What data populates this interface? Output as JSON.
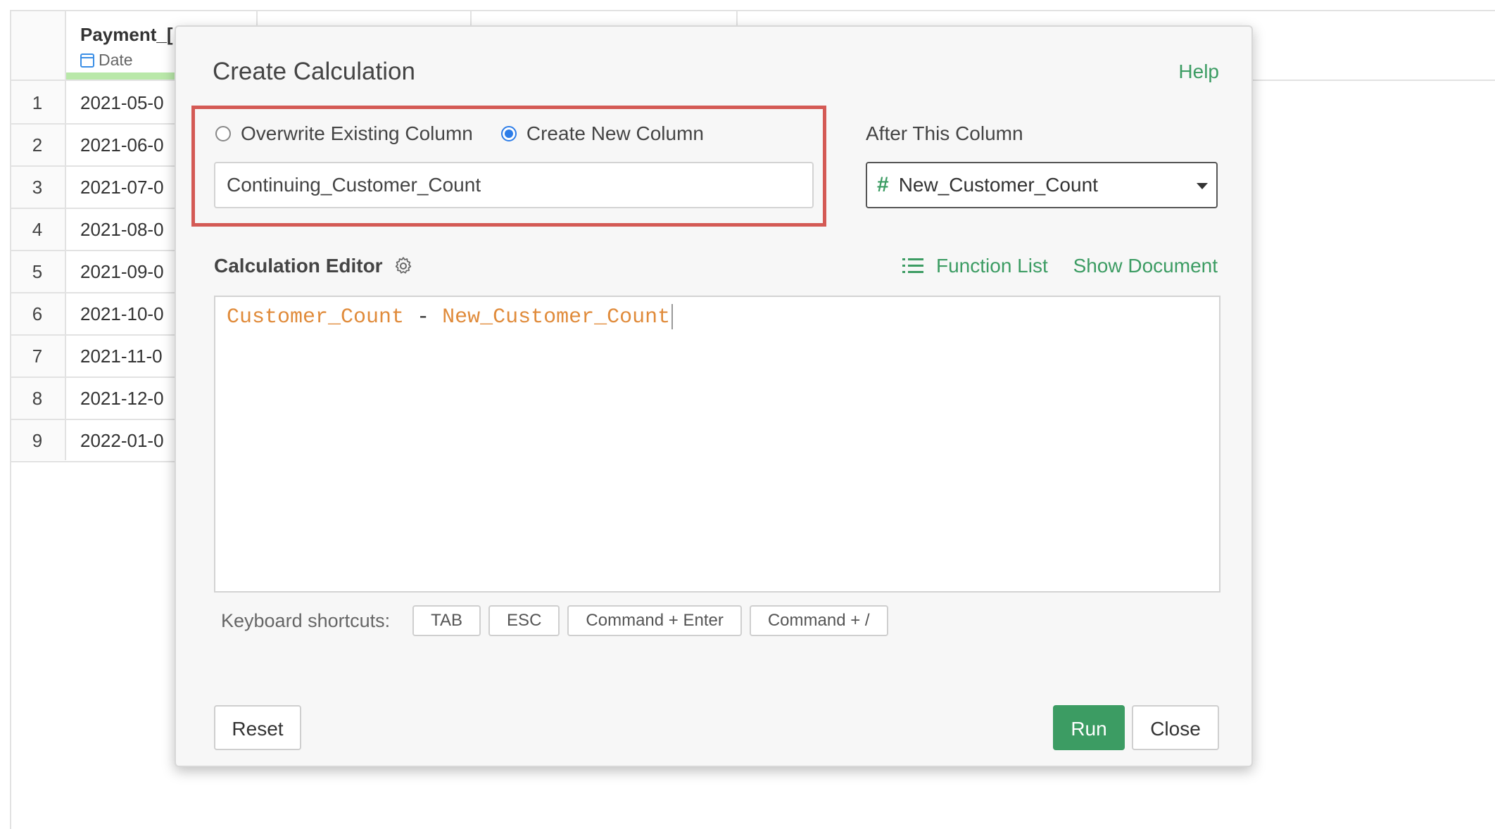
{
  "grid": {
    "column": {
      "name": "Payment_[",
      "type_label": "Date",
      "type_icon": "calendar-icon"
    },
    "rows": [
      {
        "num": "1",
        "value": "2021-05-0"
      },
      {
        "num": "2",
        "value": "2021-06-0"
      },
      {
        "num": "3",
        "value": "2021-07-0"
      },
      {
        "num": "4",
        "value": "2021-08-0"
      },
      {
        "num": "5",
        "value": "2021-09-0"
      },
      {
        "num": "6",
        "value": "2021-10-0"
      },
      {
        "num": "7",
        "value": "2021-11-0"
      },
      {
        "num": "8",
        "value": "2021-12-0"
      },
      {
        "num": "9",
        "value": "2022-01-0"
      }
    ]
  },
  "dialog": {
    "title": "Create Calculation",
    "help": "Help",
    "mode": {
      "overwrite_label": "Overwrite Existing Column",
      "create_label": "Create New Column",
      "selected": "create"
    },
    "new_column_name": "Continuing_Customer_Count",
    "after_column": {
      "label": "After This Column",
      "value": "New_Customer_Count",
      "type_icon": "hash-icon"
    },
    "editor": {
      "label": "Calculation Editor",
      "function_list": "Function List",
      "show_document": "Show Document",
      "code": {
        "left": "Customer_Count",
        "operator": "-",
        "right": "New_Customer_Count"
      }
    },
    "shortcuts": {
      "label": "Keyboard shortcuts:",
      "keys": [
        "TAB",
        "ESC",
        "Command + Enter",
        "Command + /"
      ]
    },
    "buttons": {
      "reset": "Reset",
      "run": "Run",
      "close": "Close"
    }
  },
  "colors": {
    "accent_green": "#3c9c63",
    "highlight_red": "#d45a55",
    "radio_blue": "#2d7de8",
    "code_field_orange": "#e08b3b"
  }
}
